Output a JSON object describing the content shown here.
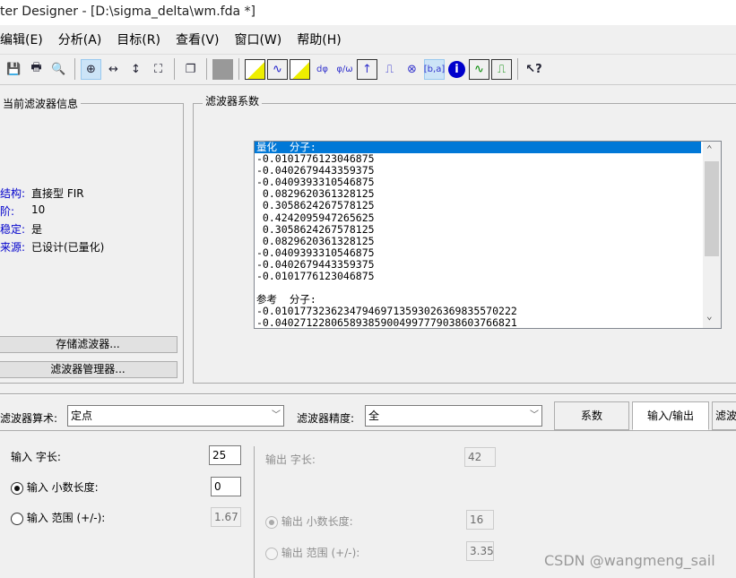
{
  "window": {
    "title": "ter Designer -  [D:\\sigma_delta\\wm.fda *]"
  },
  "menu": [
    "编辑(E)",
    "分析(A)",
    "目标(R)",
    "查看(V)",
    "窗口(W)",
    "帮助(H)"
  ],
  "toolbar": {
    "icons": [
      "save-icon",
      "print-icon",
      "print-preview-icon",
      "zoom-in-icon",
      "zoom-x-icon",
      "zoom-y-icon",
      "full-view-icon",
      "new-window-icon",
      "disabled-icon",
      "magnitude-response-icon",
      "phase-response-icon",
      "magnitude-phase-icon",
      "group-delay-icon",
      "phase-delay-icon",
      "impulse-response-icon",
      "step-response-icon",
      "pole-zero-icon",
      "filter-coefficients-icon",
      "filter-info-icon",
      "magnitude-estimate-icon",
      "noise-power-icon",
      "whats-this-help-icon"
    ]
  },
  "left_panel": {
    "title": "当前滤波器信息",
    "fields": [
      {
        "label": "结构:",
        "value": "直接型 FIR"
      },
      {
        "label": "阶:",
        "value": "10"
      },
      {
        "label": "稳定:",
        "value": "是"
      },
      {
        "label": "来源:",
        "value": "已设计(已量化)"
      }
    ],
    "store_button": "存储滤波器...",
    "manager_button": "滤波器管理器..."
  },
  "coefficients": {
    "title": "滤波器系数",
    "rows": [
      "量化  分子:",
      "-0.0101776123046875",
      "-0.0402679443359375",
      "-0.0409393310546875",
      " 0.0829620361328125",
      " 0.3058624267578125",
      " 0.4242095947265625",
      " 0.3058624267578125",
      " 0.0829620361328125",
      "-0.0409393310546875",
      "-0.0402679443359375",
      "-0.0101776123046875",
      "",
      "参考  分子:",
      "-0.010177323623479469713593026369835570222",
      "-0.040271228065893859004997779038603766821"
    ]
  },
  "quant": {
    "arith_label": "滤波器算术:",
    "arith_value": "定点",
    "precision_label": "滤波器精度:",
    "precision_value": "全",
    "tabs": [
      "系数",
      "输入/输出",
      "滤波"
    ],
    "active_tab": "输入/输出"
  },
  "io": {
    "input_word_label": "输入 字长:",
    "input_word_value": "25",
    "input_frac_label": "输入 小数长度:",
    "input_frac_value": "0",
    "input_frac_selected": true,
    "input_range_label": "输入 范围 (+/-):",
    "input_range_value": "1.67",
    "output_word_label": "输出 字长:",
    "output_word_value": "42",
    "output_frac_label": "输出 小数长度:",
    "output_frac_value": "16",
    "output_frac_selected": true,
    "output_range_label": "输出 范围 (+/-):",
    "output_range_value": "3.35"
  },
  "watermark": "CSDN @wangmeng_sail"
}
